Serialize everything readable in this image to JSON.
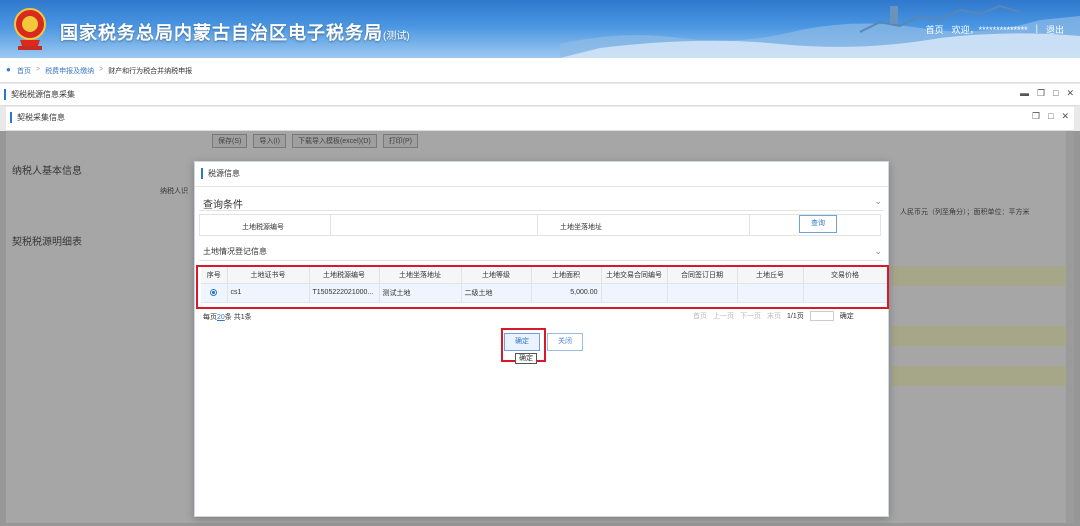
{
  "header": {
    "title": "国家税务总局内蒙古自治区电子税务局",
    "title_tag": "(测试)",
    "nav_home": "首页",
    "nav_welcome": "欢迎，**************",
    "nav_sep": "|",
    "nav_logout": "退出"
  },
  "breadcrumb": {
    "home": "首页",
    "level1": "税费申报及缴纳",
    "level2": "财产和行为税合并纳税申报",
    "sep": ">"
  },
  "outer_panel": {
    "title": "契税税源信息采集"
  },
  "inner_panel": {
    "title": "契税采集信息"
  },
  "background": {
    "toolbar": [
      "保存(S)",
      "导入(I)",
      "下载导入模板(excel)(D)",
      "打印(P)"
    ],
    "section1": "纳税人基本信息",
    "section2": "契税税源明细表",
    "note": "人民币元（列至角分）；面积单位：平方米",
    "field_hint": "纳税人识"
  },
  "dialog": {
    "title": "税源信息",
    "query_section": "查询条件",
    "label_source_no": "土地税源编号",
    "label_address": "土地坐落地址",
    "query_button": "查询",
    "land_section": "土地情况登记信息",
    "columns": [
      "序号",
      "土地证书号",
      "土地税源编号",
      "土地坐落地址",
      "土地等级",
      "土地面积",
      "土地交易合同编号",
      "合同签订日期",
      "土地丘号",
      "交易价格"
    ],
    "rows": [
      {
        "selected": true,
        "cert_no": "cs1",
        "source_no": "T1505222021000...",
        "address": "测试土地",
        "grade": "二级土地",
        "area": "5,000.00",
        "contract_no": "",
        "sign_date": "",
        "parcel_no": "",
        "price": ""
      }
    ],
    "pager": {
      "prefix": "每页",
      "page_size": "20",
      "suffix": "条 共1条",
      "first": "首页",
      "prev": "上一页",
      "next": "下一页",
      "last": "末页",
      "page_info": "1/1页",
      "go": "确定"
    },
    "ok_button": "确定",
    "close_button": "关闭",
    "tooltip": "确定"
  },
  "colors": {
    "accent": "#2e77c8",
    "highlight": "#d8192a"
  }
}
